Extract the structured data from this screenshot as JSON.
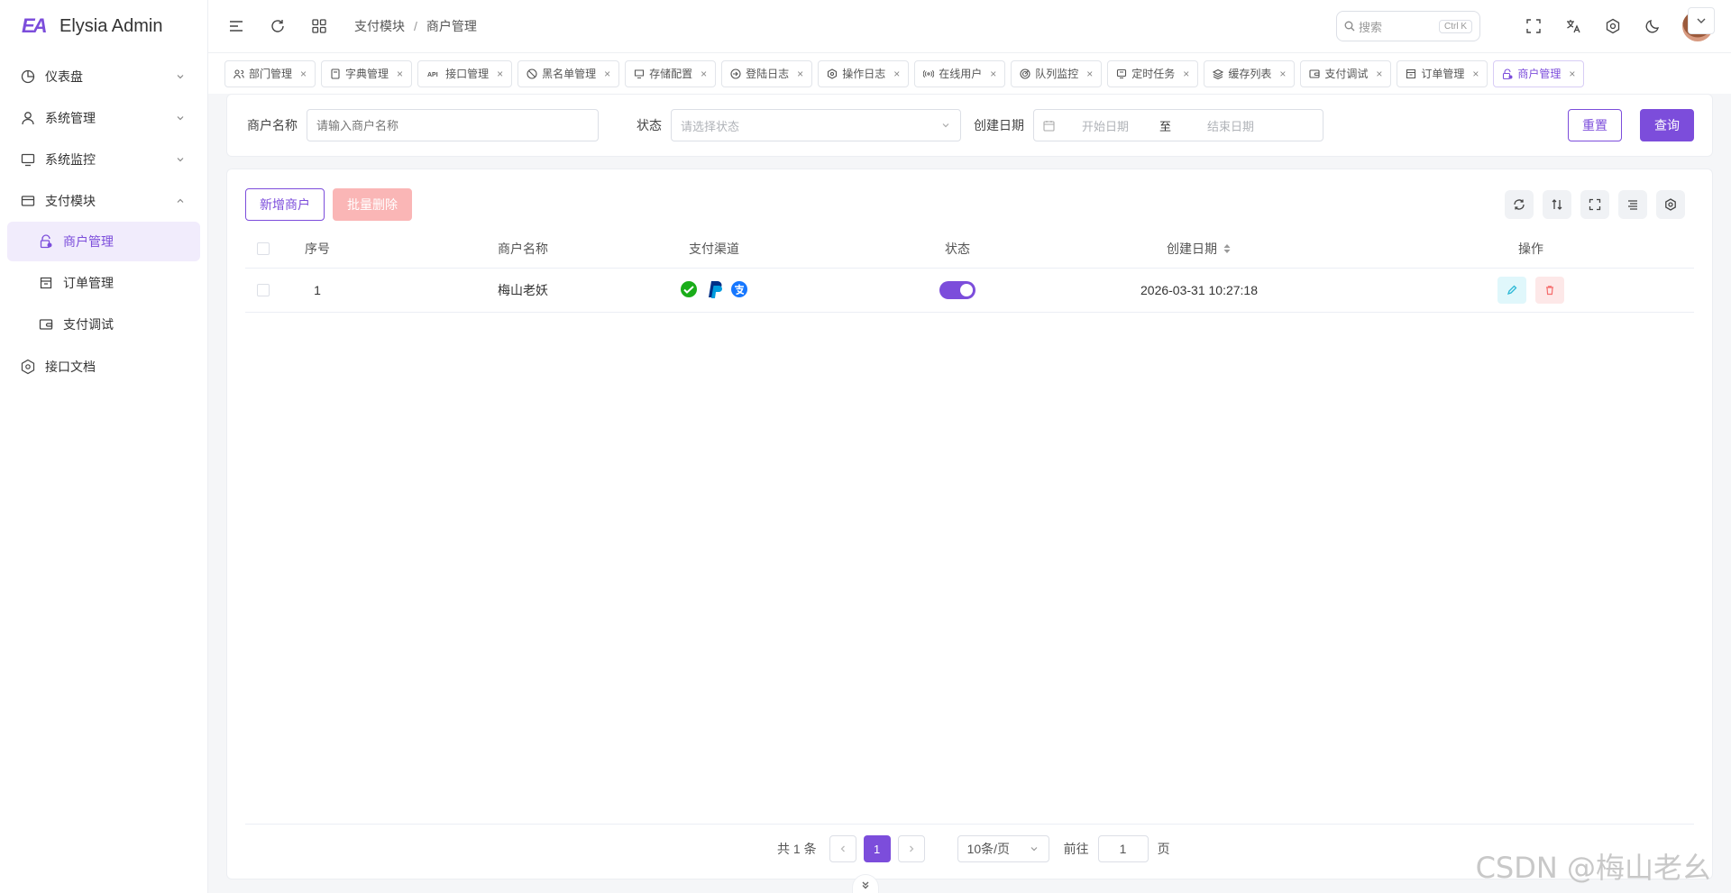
{
  "app": {
    "logo_mark": "EA",
    "title": "Elysia Admin"
  },
  "sidebar": {
    "items": [
      {
        "label": "仪表盘",
        "icon": "dashboard-icon",
        "expandable": true,
        "expanded": false
      },
      {
        "label": "系统管理",
        "icon": "user-icon",
        "expandable": true,
        "expanded": false
      },
      {
        "label": "系统监控",
        "icon": "monitor-icon",
        "expandable": true,
        "expanded": false
      },
      {
        "label": "支付模块",
        "icon": "card-icon",
        "expandable": true,
        "expanded": true,
        "children": [
          {
            "label": "商户管理",
            "icon": "merchant-icon",
            "active": true
          },
          {
            "label": "订单管理",
            "icon": "order-icon",
            "active": false
          },
          {
            "label": "支付调试",
            "icon": "wallet-icon",
            "active": false
          }
        ]
      },
      {
        "label": "接口文档",
        "icon": "api-doc-icon",
        "expandable": false
      }
    ]
  },
  "header": {
    "breadcrumb": [
      "支付模块",
      "商户管理"
    ],
    "search_placeholder": "搜索",
    "search_shortcut": "Ctrl K"
  },
  "tabs": [
    {
      "label": "部门管理",
      "icon": "dept-icon"
    },
    {
      "label": "字典管理",
      "icon": "dict-icon"
    },
    {
      "label": "接口管理",
      "icon": "api-icon",
      "prefix": "API"
    },
    {
      "label": "黑名单管理",
      "icon": "ban-icon"
    },
    {
      "label": "存储配置",
      "icon": "storage-icon"
    },
    {
      "label": "登陆日志",
      "icon": "login-log-icon"
    },
    {
      "label": "操作日志",
      "icon": "op-log-icon"
    },
    {
      "label": "在线用户",
      "icon": "online-icon"
    },
    {
      "label": "队列监控",
      "icon": "queue-icon"
    },
    {
      "label": "定时任务",
      "icon": "cron-icon"
    },
    {
      "label": "缓存列表",
      "icon": "cache-icon"
    },
    {
      "label": "支付调试",
      "icon": "wallet-icon"
    },
    {
      "label": "订单管理",
      "icon": "order-icon"
    },
    {
      "label": "商户管理",
      "icon": "merchant-icon",
      "active": true
    }
  ],
  "filter": {
    "name_label": "商户名称",
    "name_placeholder": "请输入商户名称",
    "status_label": "状态",
    "status_placeholder": "请选择状态",
    "date_label": "创建日期",
    "date_start_placeholder": "开始日期",
    "date_sep": "至",
    "date_end_placeholder": "结束日期",
    "reset_label": "重置",
    "search_label": "查询"
  },
  "table": {
    "add_label": "新增商户",
    "batch_delete_label": "批量删除",
    "columns": [
      "序号",
      "商户名称",
      "支付渠道",
      "状态",
      "创建日期",
      "操作"
    ],
    "rows": [
      {
        "index": "1",
        "name": "梅山老妖",
        "channels": [
          "wechat",
          "paypal",
          "alipay"
        ],
        "status_on": true,
        "created": "2026-03-31 10:27:18"
      }
    ]
  },
  "pagination": {
    "total_text": "共 1 条",
    "current_page": "1",
    "page_size": "10条/页",
    "goto_label": "前往",
    "goto_value": "1",
    "page_suffix": "页"
  },
  "watermark": "CSDN @梅山老幺",
  "colors": {
    "accent": "#7c4ddb",
    "danger_disabled": "#fab6b6",
    "edit_bg": "#e0f7fb",
    "delete_bg": "#fde8e8"
  }
}
